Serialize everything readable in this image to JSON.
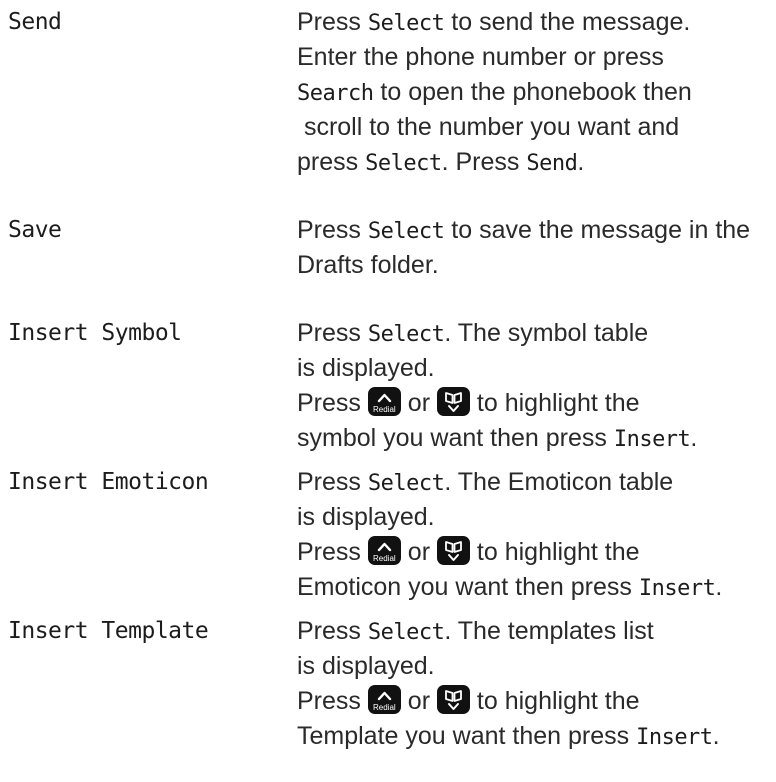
{
  "rows": [
    {
      "term": "Send",
      "lines": [
        [
          {
            "kind": "text",
            "text": "Press "
          },
          {
            "kind": "key",
            "text": "Select"
          },
          {
            "kind": "text",
            "text": " to send the message."
          }
        ],
        [
          {
            "kind": "text",
            "text": "Enter the phone number or press"
          }
        ],
        [
          {
            "kind": "key",
            "text": "Search"
          },
          {
            "kind": "text",
            "text": " to open the phonebook then"
          }
        ],
        [
          {
            "kind": "text",
            "text": " scroll to the number you want and"
          }
        ],
        [
          {
            "kind": "text",
            "text": "press "
          },
          {
            "kind": "key",
            "text": "Select"
          },
          {
            "kind": "text",
            "text": ". Press "
          },
          {
            "kind": "key",
            "text": "Send"
          },
          {
            "kind": "text",
            "text": "."
          }
        ]
      ]
    },
    {
      "term": "Save",
      "lines": [
        [
          {
            "kind": "text",
            "text": "Press "
          },
          {
            "kind": "key",
            "text": "Select"
          },
          {
            "kind": "text",
            "text": " to save the message in the"
          }
        ],
        [
          {
            "kind": "text",
            "text": "Drafts folder."
          }
        ]
      ]
    },
    {
      "term": "Insert Symbol",
      "lines": [
        [
          {
            "kind": "text",
            "text": "Press "
          },
          {
            "kind": "key",
            "text": "Select"
          },
          {
            "kind": "text",
            "text": ". The symbol table"
          }
        ],
        [
          {
            "kind": "text",
            "text": "is displayed."
          }
        ],
        [
          {
            "kind": "text",
            "text": "Press "
          },
          {
            "kind": "icon",
            "icon": "redial-up-key-icon",
            "label": "Redial"
          },
          {
            "kind": "text",
            "text": " or "
          },
          {
            "kind": "icon",
            "icon": "phonebook-down-key-icon"
          },
          {
            "kind": "text",
            "text": " to highlight the"
          }
        ],
        [
          {
            "kind": "text",
            "text": "symbol you want then press "
          },
          {
            "kind": "key",
            "text": "Insert"
          },
          {
            "kind": "text",
            "text": "."
          }
        ]
      ]
    },
    {
      "term": "Insert Emoticon",
      "lines": [
        [
          {
            "kind": "text",
            "text": "Press "
          },
          {
            "kind": "key",
            "text": "Select"
          },
          {
            "kind": "text",
            "text": ". The Emoticon table"
          }
        ],
        [
          {
            "kind": "text",
            "text": "is displayed."
          }
        ],
        [
          {
            "kind": "text",
            "text": "Press "
          },
          {
            "kind": "icon",
            "icon": "redial-up-key-icon",
            "label": "Redial"
          },
          {
            "kind": "text",
            "text": " or "
          },
          {
            "kind": "icon",
            "icon": "phonebook-down-key-icon"
          },
          {
            "kind": "text",
            "text": " to highlight the"
          }
        ],
        [
          {
            "kind": "text",
            "text": "Emoticon you want then press "
          },
          {
            "kind": "key",
            "text": "Insert"
          },
          {
            "kind": "text",
            "text": "."
          }
        ]
      ]
    },
    {
      "term": "Insert Template",
      "lines": [
        [
          {
            "kind": "text",
            "text": "Press "
          },
          {
            "kind": "key",
            "text": "Select"
          },
          {
            "kind": "text",
            "text": ". The templates list"
          }
        ],
        [
          {
            "kind": "text",
            "text": "is displayed."
          }
        ],
        [
          {
            "kind": "text",
            "text": "Press "
          },
          {
            "kind": "icon",
            "icon": "redial-up-key-icon",
            "label": "Redial"
          },
          {
            "kind": "text",
            "text": " or "
          },
          {
            "kind": "icon",
            "icon": "phonebook-down-key-icon"
          },
          {
            "kind": "text",
            "text": " to highlight the"
          }
        ],
        [
          {
            "kind": "text",
            "text": "Template you want then press "
          },
          {
            "kind": "key",
            "text": "Insert"
          },
          {
            "kind": "text",
            "text": "."
          }
        ]
      ]
    }
  ]
}
